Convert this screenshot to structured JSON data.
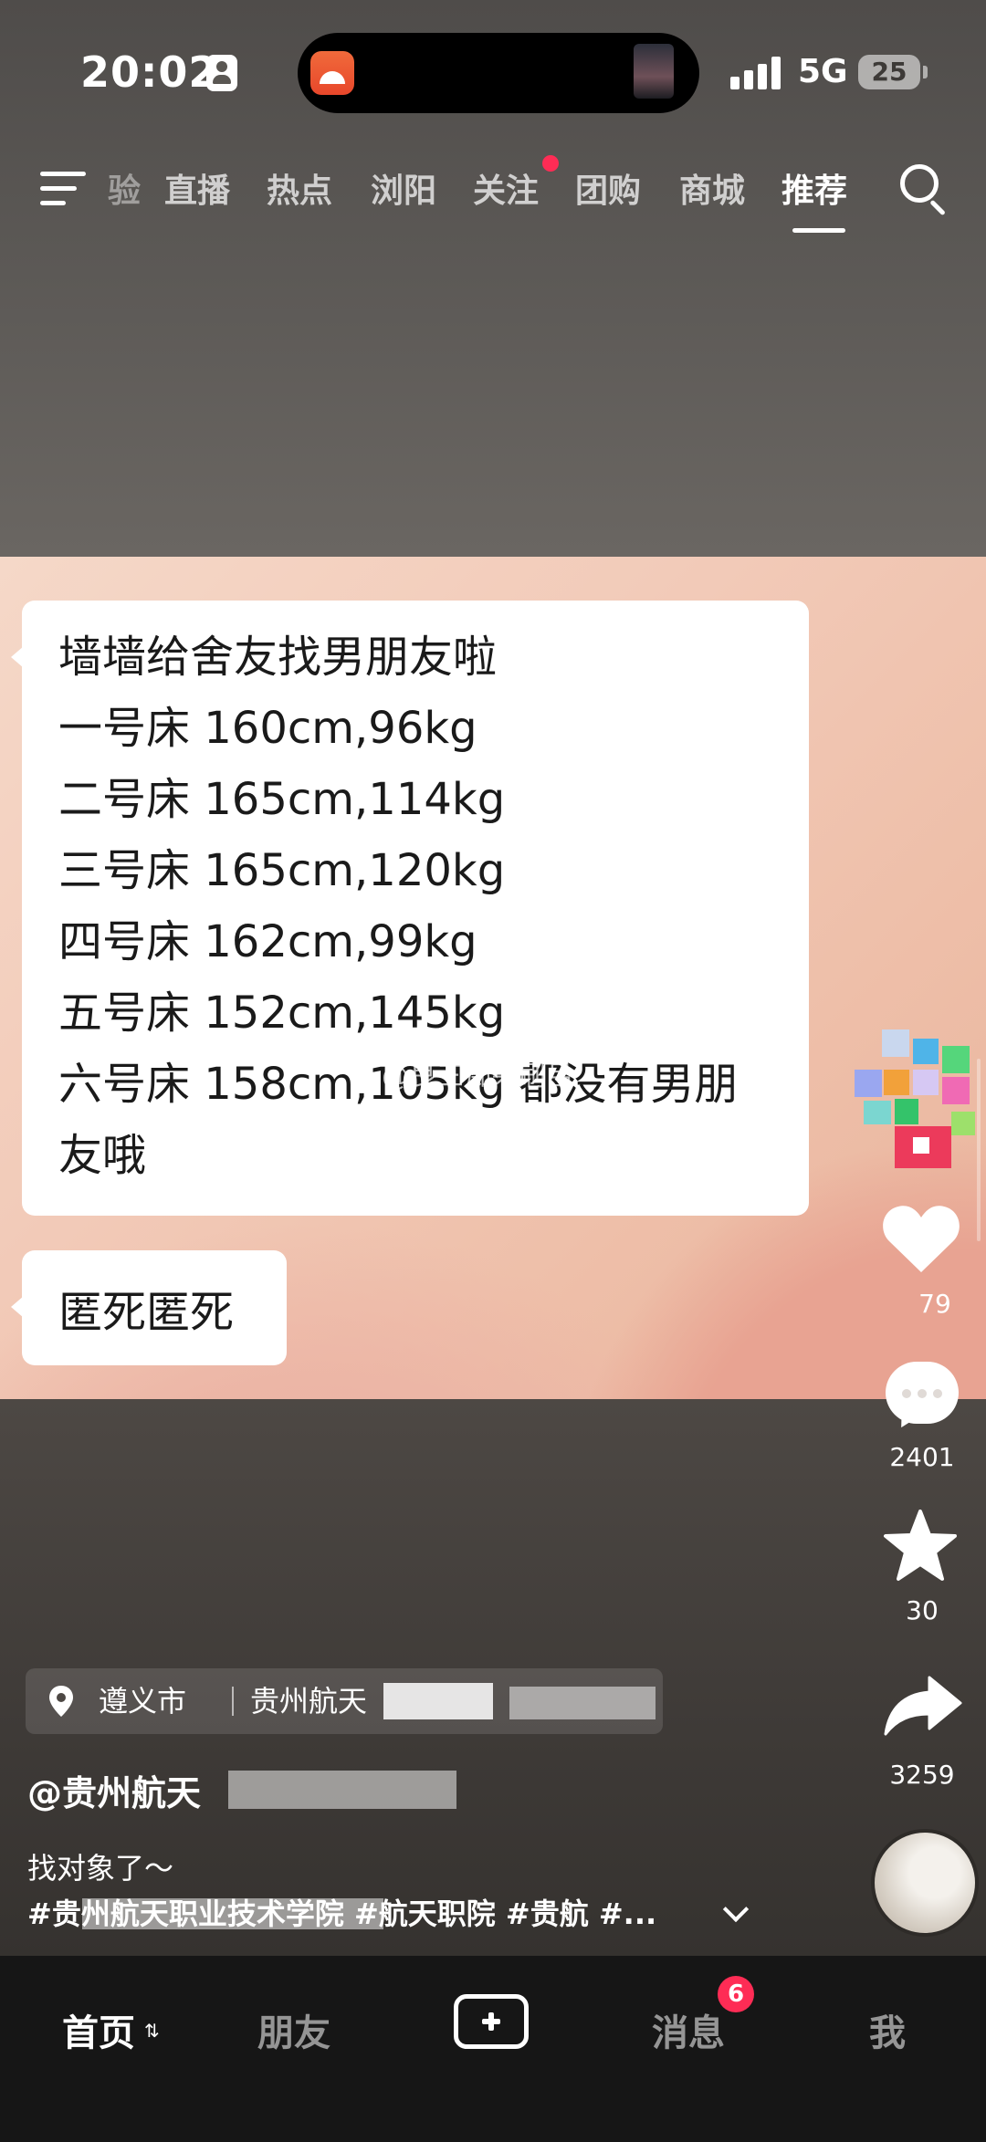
{
  "status_bar": {
    "time": "20:02",
    "network": "5G",
    "battery": "25"
  },
  "top_nav": {
    "tabs": [
      {
        "label": "验"
      },
      {
        "label": "直播"
      },
      {
        "label": "热点"
      },
      {
        "label": "浏阳"
      },
      {
        "label": "关注"
      },
      {
        "label": "团购"
      },
      {
        "label": "商城"
      },
      {
        "label": "推荐"
      }
    ],
    "active_tab": "推荐"
  },
  "chat": {
    "message_lines": [
      "墙墙给舍友找男朋友啦",
      "一号床 160cm,96kg",
      "二号床 165cm,114kg",
      "三号床 165cm,120kg",
      "四号床 162cm,99kg",
      "五号床 152cm,145kg",
      "六号床 158cm,105kg 都没有男朋",
      "友哦"
    ],
    "reply": "匿死匿死",
    "watermark": "@良三痴呆刷吕"
  },
  "actions": {
    "like_count": "79",
    "comment_count": "2401",
    "favorite_count": "30",
    "share_count": "3259",
    "accent_color": "#fe2c55"
  },
  "post": {
    "location_city": "遵义市",
    "location_place": "贵州航天",
    "author": "@贵州航天",
    "caption": "找对象了～",
    "hashtags": "#贵州航天职业技术学院 #航天职院 #贵航 #..."
  },
  "bottom_tabs": {
    "home": "首页",
    "friends": "朋友",
    "messages": "消息",
    "messages_badge": "6",
    "me": "我"
  }
}
